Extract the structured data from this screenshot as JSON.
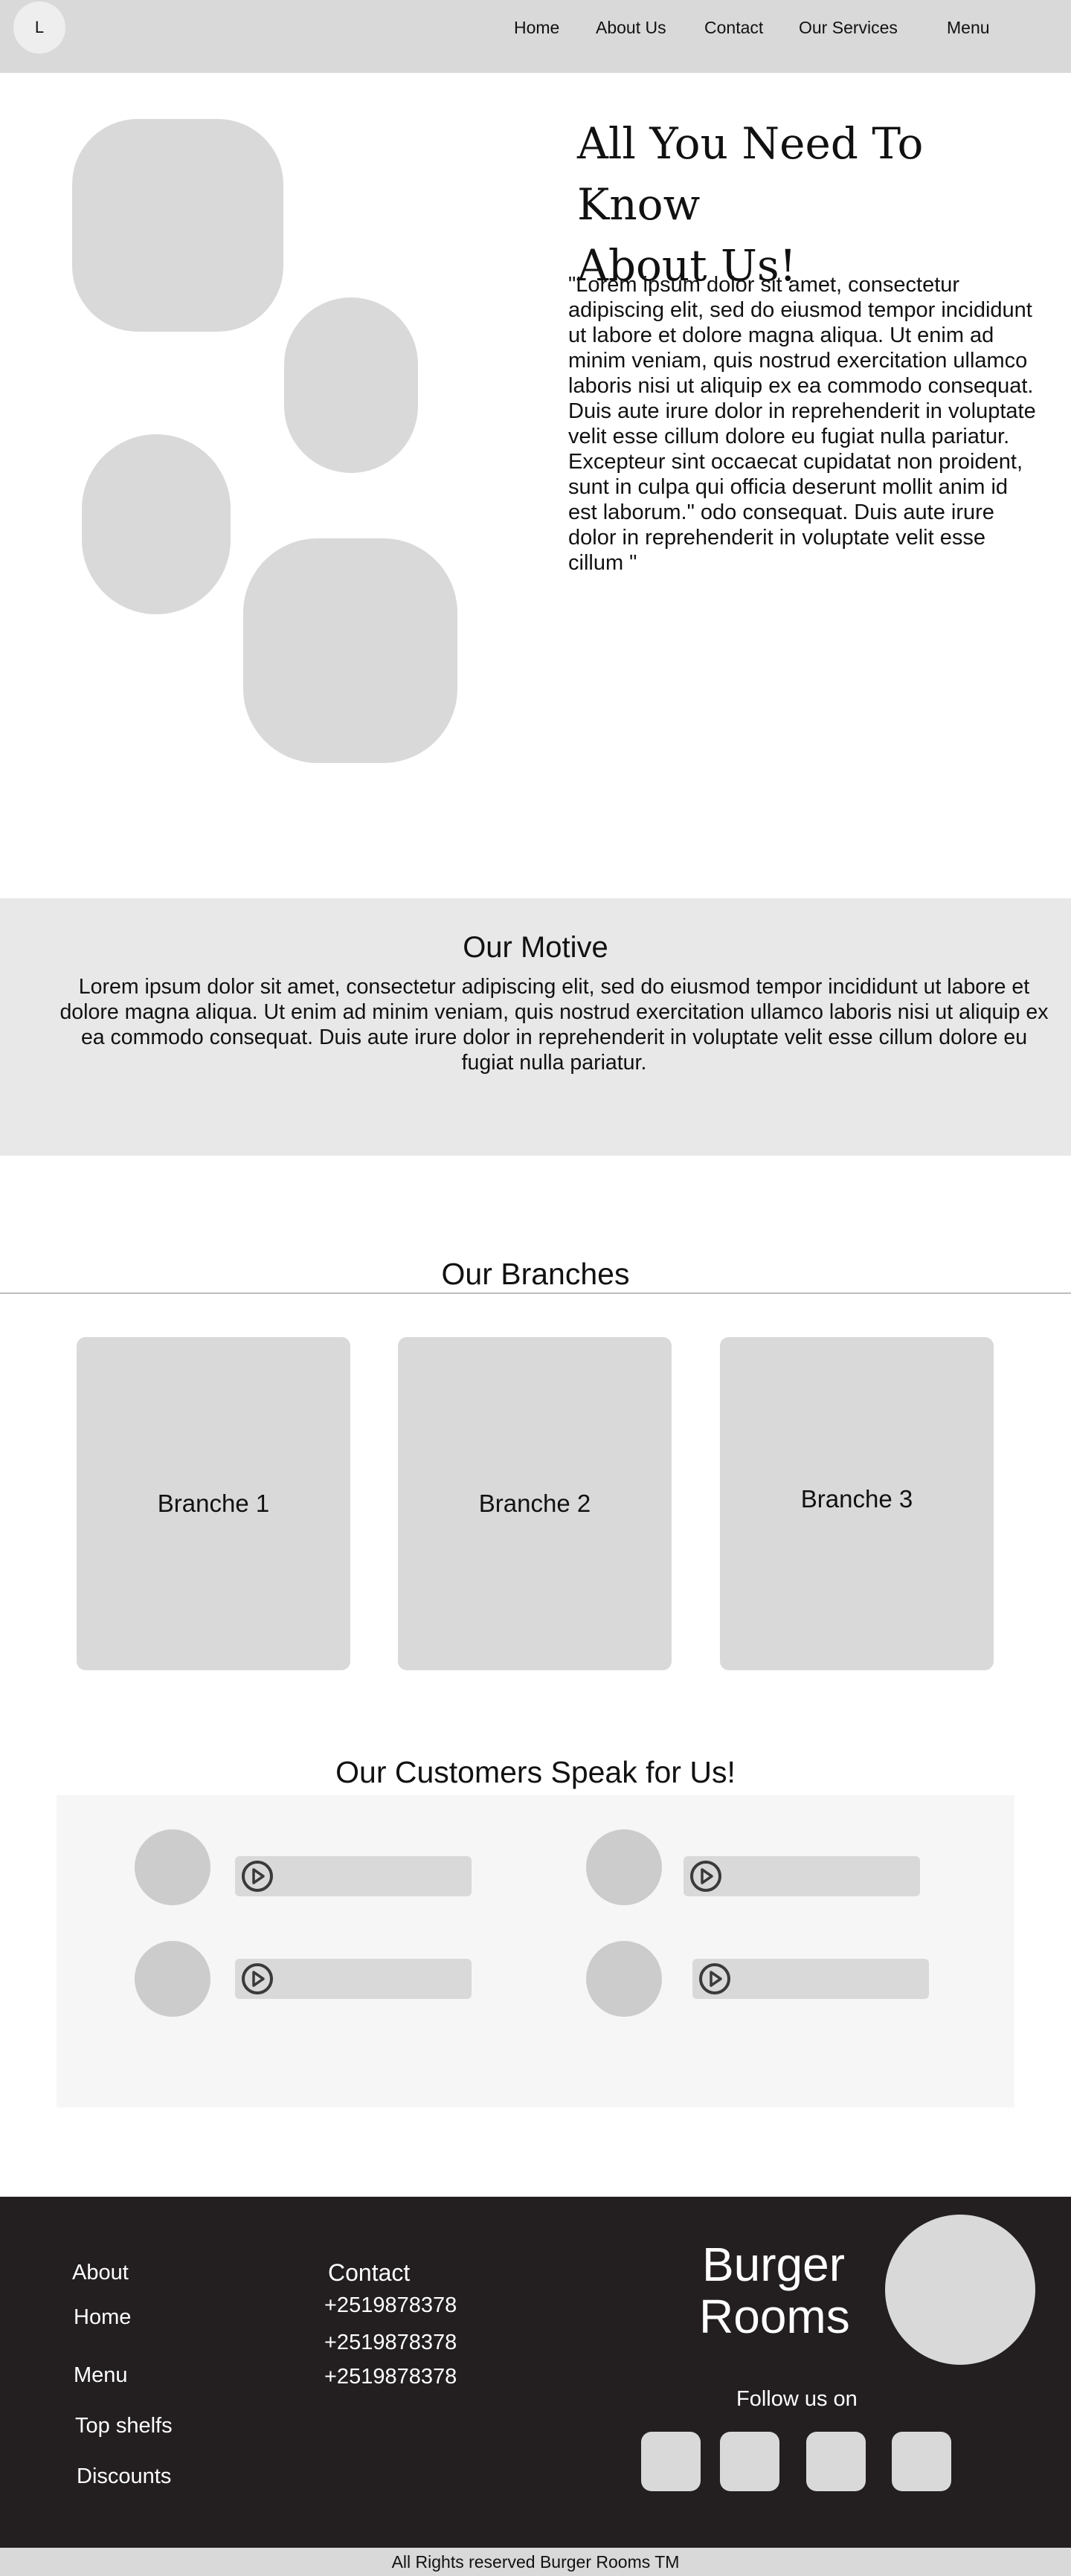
{
  "header": {
    "logo_letter": "L",
    "nav": [
      "Home",
      "About Us",
      "Contact",
      "Our Services",
      "Menu"
    ]
  },
  "about": {
    "title_line1": "All You Need To Know",
    "title_line2": "About Us!",
    "body": "\"Lorem ipsum dolor sit amet, consectetur adipiscing elit, sed do eiusmod tempor incididunt ut labore et dolore magna aliqua. Ut enim ad minim veniam, quis nostrud exercitation ullamco laboris nisi ut aliquip ex ea commodo consequat. Duis aute irure dolor in reprehenderit in voluptate velit esse cillum dolore eu fugiat nulla pariatur. Excepteur sint occaecat cupidatat non proident, sunt in culpa qui officia deserunt mollit anim id est laborum.\" odo consequat. Duis aute irure dolor in reprehenderit in voluptate velit esse cillum \""
  },
  "motive": {
    "title": "Our Motive",
    "body": "Lorem ipsum dolor sit amet, consectetur adipiscing elit, sed do eiusmod tempor incididunt ut labore et dolore magna aliqua. Ut enim ad minim veniam, quis nostrud exercitation ullamco laboris nisi ut aliquip ex ea commodo consequat. Duis aute irure dolor in reprehenderit in voluptate velit esse cillum dolore eu fugiat nulla pariatur."
  },
  "branches": {
    "title": "Our Branches",
    "items": [
      "Branche 1",
      "Branche 2",
      "Branche 3"
    ]
  },
  "testimonials": {
    "title": "Our Customers Speak for Us!",
    "player_icon": "play-circle-icon",
    "count": 4
  },
  "footer": {
    "links": [
      "About",
      "Home",
      "Menu",
      "Top shelfs",
      "Discounts"
    ],
    "contact_heading": "Contact",
    "phones": [
      "+2519878378",
      "+2519878378",
      "+2519878378"
    ],
    "brand_line1": "Burger",
    "brand_line2": "Rooms",
    "follow_label": "Follow us on",
    "social_icons": [
      "social-icon-1",
      "social-icon-2",
      "social-icon-3",
      "social-icon-4"
    ]
  },
  "copyright": "All Rights reserved Burger Rooms TM",
  "colors": {
    "nav_bg": "#d9d9d9",
    "placeholder": "#d9d9d9",
    "motive_bg": "#e8e8e8",
    "footer_bg": "#231f20"
  }
}
